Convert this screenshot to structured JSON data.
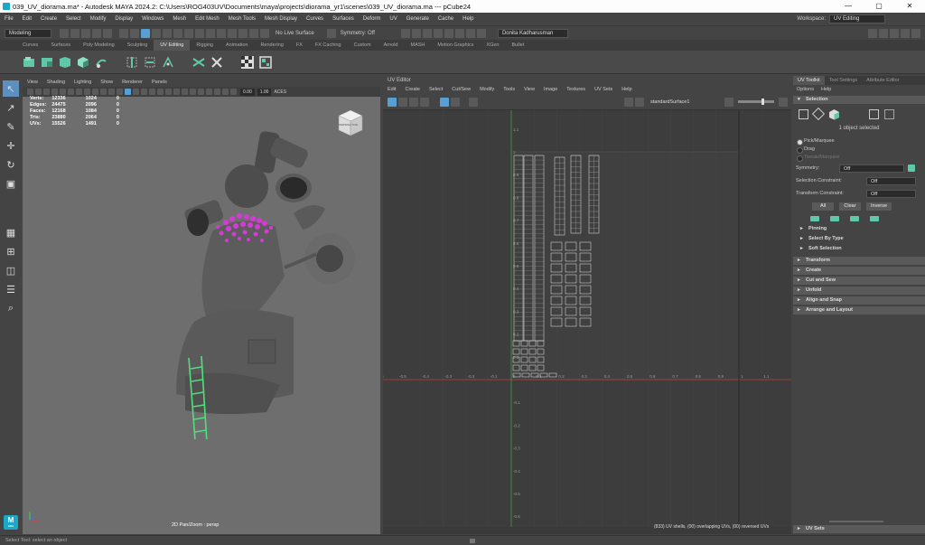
{
  "window": {
    "title": "039_UV_diorama.ma* - Autodesk MAYA 2024.2: C:\\Users\\ROG403UV\\Documents\\maya\\projects\\diorama_yr1\\scenes\\039_UV_diorama.ma   ---   pCube24",
    "buttons": [
      "—",
      "▢",
      "✕"
    ]
  },
  "menubar": {
    "items": [
      "File",
      "Edit",
      "Create",
      "Select",
      "Modify",
      "Display",
      "Windows",
      "Mesh",
      "Edit Mesh",
      "Mesh Tools",
      "Mesh Display",
      "Curves",
      "Surfaces",
      "Deform",
      "UV",
      "Generate",
      "Cache",
      "Help"
    ],
    "workspace_label": "Workspace:",
    "workspace_value": "UV Editing"
  },
  "statusline": {
    "menuset": "Modeling",
    "live_surface": "No Live Surface",
    "symmetry": "Symmetry: Off",
    "user": "Donita Kadharusman"
  },
  "shelf": {
    "tabs": [
      "Curves",
      "Surfaces",
      "Poly Modeling",
      "Sculpting",
      "UV Editing",
      "Rigging",
      "Animation",
      "Rendering",
      "FX",
      "FX Caching",
      "Custom",
      "Arnold",
      "MASH",
      "Motion Graphics",
      "XGen",
      "Bullet"
    ],
    "active_tab": "UV Editing"
  },
  "viewport": {
    "menu": [
      "View",
      "Shading",
      "Lighting",
      "Show",
      "Renderer",
      "Panels"
    ],
    "field1": "0.00",
    "field2": "1.00",
    "hud": {
      "rows": [
        {
          "label": "Verts:",
          "a": "12336",
          "b": "1024",
          "c": "0"
        },
        {
          "label": "Edges:",
          "a": "24475",
          "b": "2096",
          "c": "0"
        },
        {
          "label": "Faces:",
          "a": "12168",
          "b": "1084",
          "c": "0"
        },
        {
          "label": "Tris:",
          "a": "23880",
          "b": "2064",
          "c": "0"
        },
        {
          "label": "UVs:",
          "a": "15526",
          "b": "1491",
          "c": "0"
        }
      ]
    },
    "viewcube_label": "PERSPECTIVE",
    "camera_label": "2D Pan/Zoom : persp"
  },
  "uv_editor": {
    "title": "UV Editor",
    "menu": [
      "Edit",
      "Create",
      "Select",
      "Cut/Sew",
      "Modify",
      "Tools",
      "View",
      "Image",
      "Textures",
      "UV Sets",
      "Help"
    ],
    "surface": "standardSurface1",
    "status": "(833) UV shells, (00) overlapping UVs, (00) reversed UVs",
    "x_ticks": [
      "-0.8",
      "-0.7",
      "-0.6",
      "-0.5",
      "-0.4",
      "-0.3",
      "-0.2",
      "-0.1",
      "0",
      "0.1",
      "0.2",
      "0.3",
      "0.4",
      "0.5",
      "0.6",
      "0.7",
      "0.8",
      "0.9",
      "1",
      "1.1"
    ],
    "y_ticks": [
      "1.1",
      "1",
      "0.9",
      "0.8",
      "0.7",
      "0.6",
      "0.5",
      "0.4",
      "0.3",
      "0.2",
      "0.1",
      "-0.1",
      "-0.2",
      "-0.3",
      "-0.4",
      "-0.5",
      "-0.6",
      "-0.7",
      "-0.8"
    ]
  },
  "toolkit": {
    "tabs": [
      "UV Toolkit",
      "Tool Settings",
      "Attribute Editor"
    ],
    "menu": [
      "Options",
      "Help"
    ],
    "selection_header": "Selection",
    "selected_count": "1 object selected",
    "radios": [
      "Pick/Marquee",
      "Drag",
      "Tweak/Marquee"
    ],
    "symmetry_label": "Symmetry:",
    "symmetry_value": "Off",
    "sel_constraint_label": "Selection Constraint:",
    "sel_constraint_value": "Off",
    "transform_constraint_label": "Transform Constraint:",
    "transform_constraint_value": "Off",
    "buttons": [
      "All",
      "Clear",
      "Inverse"
    ],
    "subsections": [
      "Pinning",
      "Select By Type",
      "Soft Selection"
    ],
    "sections": [
      "Transform",
      "Create",
      "Cut and Sew",
      "Unfold",
      "Align and Snap",
      "Arrange and Layout"
    ],
    "uv_sets": "UV Sets"
  },
  "helpline": {
    "text": "Select Tool: select an object"
  },
  "colors": {
    "accent": "#5fc8a8",
    "selection": "#d63ad6",
    "highlight_green": "#4fe07a"
  }
}
